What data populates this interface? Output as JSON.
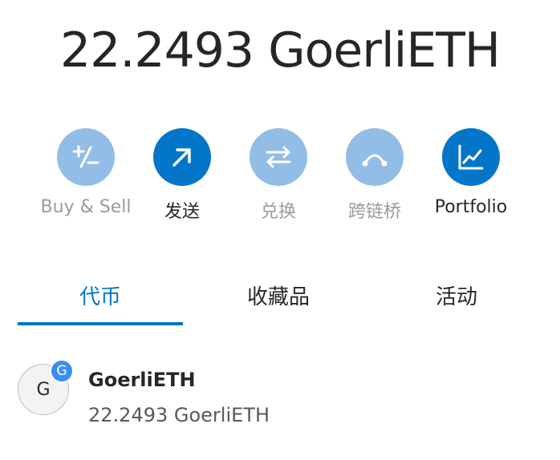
{
  "balance": {
    "amount": "22.2493",
    "symbol": "GoerliETH"
  },
  "actions": [
    {
      "label": "Buy & Sell",
      "icon": "plus-minus-icon",
      "state": "disabled"
    },
    {
      "label": "发送",
      "icon": "arrow-up-right-icon",
      "state": "active"
    },
    {
      "label": "兑换",
      "icon": "swap-arrows-icon",
      "state": "disabled"
    },
    {
      "label": "跨链桥",
      "icon": "bridge-icon",
      "state": "disabled"
    },
    {
      "label": "Portfolio",
      "icon": "chart-icon",
      "state": "active"
    }
  ],
  "tabs": [
    {
      "label": "代币",
      "active": true
    },
    {
      "label": "收藏品",
      "active": false
    },
    {
      "label": "活动",
      "active": false
    }
  ],
  "tokens": [
    {
      "avatar_letter": "G",
      "network_letter": "G",
      "name": "GoerliETH",
      "balance": "22.2493 GoerliETH"
    }
  ],
  "colors": {
    "accent": "#0376c9",
    "accent_disabled": "#92bde6",
    "network_badge": "#3a8ef0",
    "text_primary": "#24272a",
    "text_muted": "#9b9b9b"
  }
}
